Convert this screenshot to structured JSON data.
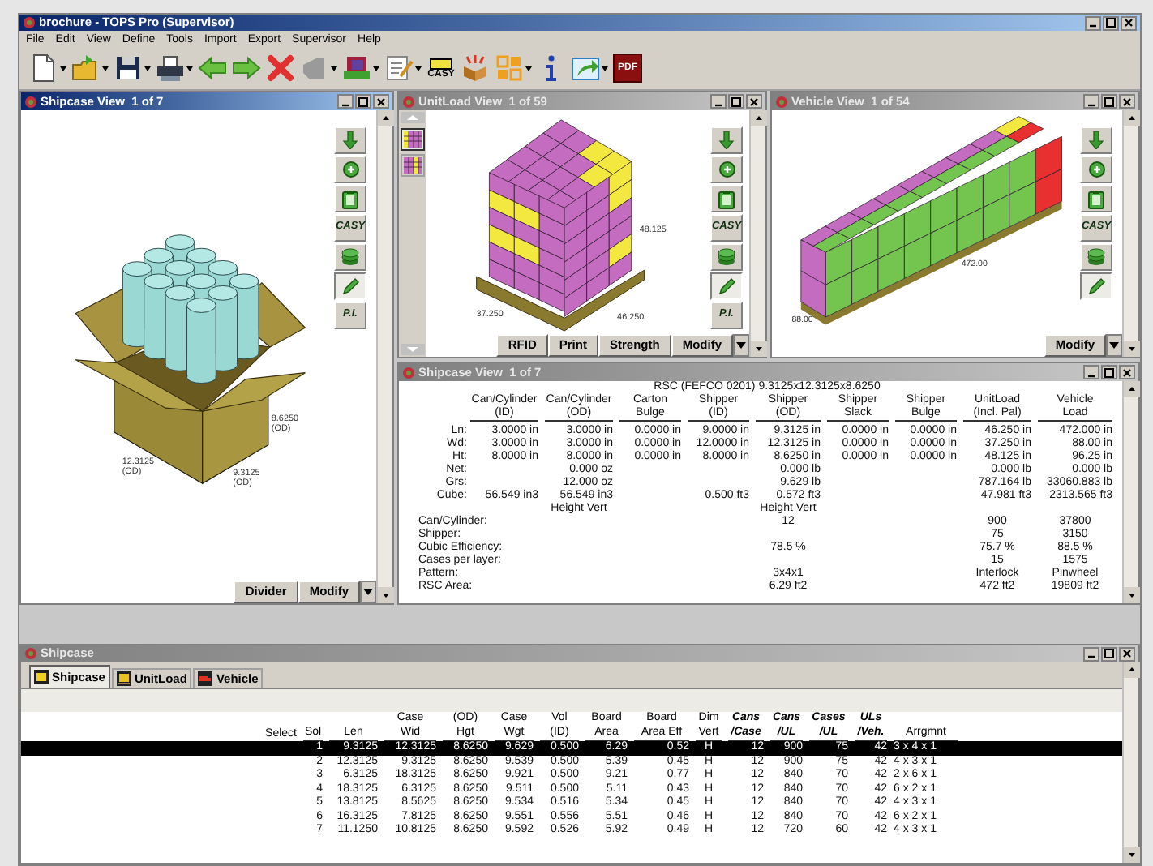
{
  "window": {
    "title": "brochure - TOPS Pro (Supervisor)"
  },
  "menu": [
    "File",
    "Edit",
    "View",
    "Define",
    "Tools",
    "Import",
    "Export",
    "Supervisor",
    "Help"
  ],
  "toolbar": [
    {
      "kind": "new",
      "dropdown": true
    },
    {
      "kind": "open",
      "dropdown": true
    },
    {
      "kind": "save",
      "dropdown": true
    },
    {
      "kind": "print",
      "dropdown": true
    },
    {
      "kind": "back",
      "dropdown": false
    },
    {
      "kind": "forward",
      "dropdown": false
    },
    {
      "kind": "delete",
      "dropdown": false
    },
    {
      "kind": "shape",
      "dropdown": true
    },
    {
      "kind": "blocks",
      "dropdown": true
    },
    {
      "kind": "notes",
      "dropdown": true
    },
    {
      "kind": "casy",
      "label": "CASY",
      "dropdown": false
    },
    {
      "kind": "box",
      "dropdown": false
    },
    {
      "kind": "grid",
      "dropdown": true
    },
    {
      "kind": "info",
      "dropdown": false
    },
    {
      "kind": "export",
      "dropdown": true
    },
    {
      "kind": "pdf",
      "label": "PDF",
      "dropdown": false
    }
  ],
  "shipcase_view": {
    "title": "Shipcase View  1 of 7",
    "active": true,
    "side_tools": [
      {
        "kind": "down",
        "selected": false
      },
      {
        "kind": "zoom",
        "selected": false
      },
      {
        "kind": "clipboard",
        "selected": false
      },
      {
        "kind": "label",
        "label": "CASY",
        "selected": false
      },
      {
        "kind": "layers",
        "selected": false
      },
      {
        "kind": "pencil",
        "selected": true
      },
      {
        "kind": "label",
        "label": "P.I.",
        "selected": false
      }
    ],
    "dims": [
      {
        "value": "8.6250",
        "note": "(OD)"
      },
      {
        "value": "12.3125",
        "note": "(OD)"
      },
      {
        "value": "9.3125",
        "note": "(OD)"
      }
    ],
    "buttons": [
      "Divider",
      "Modify"
    ]
  },
  "unitload_view": {
    "title": "UnitLoad View  1 of 59",
    "active": false,
    "patterns": [
      {
        "selected": true
      },
      {
        "selected": false
      }
    ],
    "side_tools": [
      {
        "kind": "down",
        "selected": false
      },
      {
        "kind": "zoom",
        "selected": false
      },
      {
        "kind": "clipboard",
        "selected": false
      },
      {
        "kind": "label",
        "label": "CASY",
        "selected": false
      },
      {
        "kind": "layers",
        "selected": false
      },
      {
        "kind": "pencil",
        "selected": true
      },
      {
        "kind": "label",
        "label": "P.I.",
        "selected": false
      }
    ],
    "dims": [
      "48.125",
      "37.250",
      "46.250"
    ],
    "buttons": [
      "RFID",
      "Print",
      "Strength",
      "Modify"
    ]
  },
  "vehicle_view": {
    "title": "Vehicle View  1 of 54",
    "active": false,
    "side_tools": [
      {
        "kind": "down",
        "selected": false
      },
      {
        "kind": "zoom",
        "selected": false
      },
      {
        "kind": "clipboard",
        "selected": false
      },
      {
        "kind": "label",
        "label": "CASY",
        "selected": false
      },
      {
        "kind": "layers",
        "selected": false
      },
      {
        "kind": "pencil",
        "selected": true
      }
    ],
    "dims": [
      "472.00",
      "88.00"
    ],
    "buttons": [
      "Modify"
    ]
  },
  "detail_view": {
    "title": "Shipcase View  1 of 7",
    "active": false,
    "heading": "RSC (FEFCO 0201) 9.3125x12.3125x8.6250",
    "columns": [
      [
        "Can/Cylinder",
        "(ID)"
      ],
      [
        "Can/Cylinder",
        "(OD)"
      ],
      [
        "Carton",
        "Bulge"
      ],
      [
        "Shipper",
        "(ID)"
      ],
      [
        "Shipper",
        "(OD)"
      ],
      [
        "Shipper",
        "Slack"
      ],
      [
        "Shipper",
        "Bulge"
      ],
      [
        "UnitLoad",
        "(Incl. Pal)"
      ],
      [
        "Vehicle",
        "Load"
      ]
    ],
    "rows": [
      {
        "kind": "measure",
        "label": "Ln:",
        "values": {
          "can_id": "3.0000 in",
          "can_od": "3.0000 in",
          "carton_bulge": "0.0000 in",
          "shipper_id": "9.0000 in",
          "shipper_od": "9.3125 in",
          "shipper_slack": "0.0000 in",
          "shipper_bulge": "0.0000 in",
          "unitload": "46.250 in",
          "vehicle": "472.000 in"
        }
      },
      {
        "kind": "measure",
        "label": "Wd:",
        "values": {
          "can_id": "3.0000 in",
          "can_od": "3.0000 in",
          "carton_bulge": "0.0000 in",
          "shipper_id": "12.0000 in",
          "shipper_od": "12.3125 in",
          "shipper_slack": "0.0000 in",
          "shipper_bulge": "0.0000 in",
          "unitload": "37.250 in",
          "vehicle": "88.00 in"
        }
      },
      {
        "kind": "measure",
        "label": "Ht:",
        "values": {
          "can_id": "8.0000 in",
          "can_od": "8.0000 in",
          "carton_bulge": "0.0000 in",
          "shipper_id": "8.0000 in",
          "shipper_od": "8.6250 in",
          "shipper_slack": "0.0000 in",
          "shipper_bulge": "0.0000 in",
          "unitload": "48.125 in",
          "vehicle": "96.25 in"
        }
      },
      {
        "kind": "measure",
        "label": "Net:",
        "values": {
          "can_od": "0.000 oz",
          "shipper_od": "0.000 lb",
          "unitload": "0.000 lb",
          "vehicle": "0.000 lb"
        }
      },
      {
        "kind": "measure",
        "label": "Grs:",
        "values": {
          "can_od": "12.000 oz",
          "shipper_od": "9.629 lb",
          "unitload": "787.164 lb",
          "vehicle": "33060.883 lb"
        }
      },
      {
        "kind": "measure",
        "label": "Cube:",
        "values": {
          "can_id": "56.549 in3",
          "can_od": "56.549 in3",
          "shipper_id": "0.500 ft3",
          "shipper_od": "0.572 ft3",
          "unitload": "47.981 ft3",
          "vehicle": "2313.565 ft3"
        }
      },
      {
        "kind": "orientation",
        "values": {
          "can_od": "Height Vert",
          "shipper_od": "Height Vert"
        }
      }
    ],
    "summary": [
      {
        "label": "Can/Cylinder:",
        "shipper": "12",
        "unitload": "900",
        "vehicle": "37800"
      },
      {
        "label": "Shipper:",
        "unitload": "75",
        "vehicle": "3150"
      },
      {
        "label": "Cubic Efficiency:",
        "shipper": "78.5 %",
        "unitload": "75.7 %",
        "vehicle": "88.5 %"
      },
      {
        "label": "Cases per layer:",
        "unitload": "15",
        "vehicle": "1575"
      },
      {
        "label": "Pattern:",
        "shipper": "3x4x1",
        "unitload": "Interlock",
        "vehicle": "Pinwheel"
      },
      {
        "label": "RSC Area:",
        "shipper": "6.29 ft2",
        "unitload": "472 ft2",
        "vehicle": "19809 ft2"
      }
    ]
  },
  "bottom_panel": {
    "title": "Shipcase",
    "active": false,
    "tabs": [
      {
        "kind": "shipcase",
        "label": "Shipcase",
        "selected": true
      },
      {
        "kind": "unitload",
        "label": "UnitLoad",
        "selected": false
      },
      {
        "kind": "vehicle",
        "label": "Vehicle",
        "selected": false
      }
    ],
    "select_header": "Select",
    "columns": [
      {
        "lines": [
          "Sol"
        ],
        "emphasis": false
      },
      {
        "lines": [
          "Len"
        ],
        "emphasis": false
      },
      {
        "lines": [
          "Case",
          "Wid"
        ],
        "emphasis": false
      },
      {
        "lines": [
          "(OD)",
          "Hgt"
        ],
        "emphasis": false
      },
      {
        "lines": [
          "Case",
          "Wgt"
        ],
        "emphasis": false
      },
      {
        "lines": [
          "Vol",
          "(ID)"
        ],
        "emphasis": false
      },
      {
        "lines": [
          "Board",
          "Area"
        ],
        "emphasis": false
      },
      {
        "lines": [
          "Board",
          "Area Eff"
        ],
        "emphasis": false
      },
      {
        "lines": [
          "Dim",
          "Vert"
        ],
        "emphasis": false
      },
      {
        "lines": [
          "Cans",
          "/Case"
        ],
        "emphasis": true
      },
      {
        "lines": [
          "Cans",
          "/UL"
        ],
        "emphasis": true
      },
      {
        "lines": [
          "Cases",
          "/UL"
        ],
        "emphasis": true
      },
      {
        "lines": [
          "ULs",
          "/Veh."
        ],
        "emphasis": true
      },
      {
        "lines": [
          "Arrgmnt"
        ],
        "emphasis": false
      }
    ],
    "rows": [
      {
        "selected": true,
        "cells": [
          "1",
          "9.3125",
          "12.3125",
          "8.6250",
          "9.629",
          "0.500",
          "6.29",
          "0.52",
          "H",
          "12",
          "900",
          "75",
          "42",
          "3 x 4 x 1"
        ]
      },
      {
        "selected": false,
        "cells": [
          "2",
          "12.3125",
          "9.3125",
          "8.6250",
          "9.539",
          "0.500",
          "5.39",
          "0.45",
          "H",
          "12",
          "900",
          "75",
          "42",
          "4 x 3 x 1"
        ]
      },
      {
        "selected": false,
        "cells": [
          "3",
          "6.3125",
          "18.3125",
          "8.6250",
          "9.921",
          "0.500",
          "9.21",
          "0.77",
          "H",
          "12",
          "840",
          "70",
          "42",
          "2 x 6 x 1"
        ]
      },
      {
        "selected": false,
        "cells": [
          "4",
          "18.3125",
          "6.3125",
          "8.6250",
          "9.511",
          "0.500",
          "5.11",
          "0.43",
          "H",
          "12",
          "840",
          "70",
          "42",
          "6 x 2 x 1"
        ]
      },
      {
        "selected": false,
        "cells": [
          "5",
          "13.8125",
          "8.5625",
          "8.6250",
          "9.534",
          "0.516",
          "5.34",
          "0.45",
          "H",
          "12",
          "840",
          "70",
          "42",
          "4 x 3 x 1"
        ]
      },
      {
        "selected": false,
        "cells": [
          "6",
          "16.3125",
          "7.8125",
          "8.6250",
          "9.551",
          "0.556",
          "5.51",
          "0.46",
          "H",
          "12",
          "840",
          "70",
          "42",
          "6 x 2 x 1"
        ]
      },
      {
        "selected": false,
        "cells": [
          "7",
          "11.1250",
          "10.8125",
          "8.6250",
          "9.592",
          "0.526",
          "5.92",
          "0.49",
          "H",
          "12",
          "720",
          "60",
          "42",
          "4 x 3 x 1"
        ]
      }
    ]
  }
}
